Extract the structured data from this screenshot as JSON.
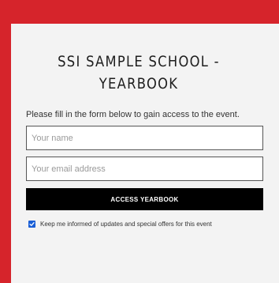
{
  "colors": {
    "brand_red": "#d6242b",
    "panel_bg": "#f3f3f3",
    "button_bg": "#000000",
    "checkbox_accent": "#1a5fd6"
  },
  "form": {
    "title": "SSI SAMPLE SCHOOL - YEARBOOK",
    "intro": "Please fill in the form below to gain access to the event.",
    "name_placeholder": "Your name",
    "email_placeholder": "Your email address",
    "submit_label": "ACCESS YEARBOOK",
    "consent_checked": true,
    "consent_label": "Keep me informed of updates and special offers for this event"
  },
  "icons": {
    "checkbox": "checkmark-icon"
  }
}
